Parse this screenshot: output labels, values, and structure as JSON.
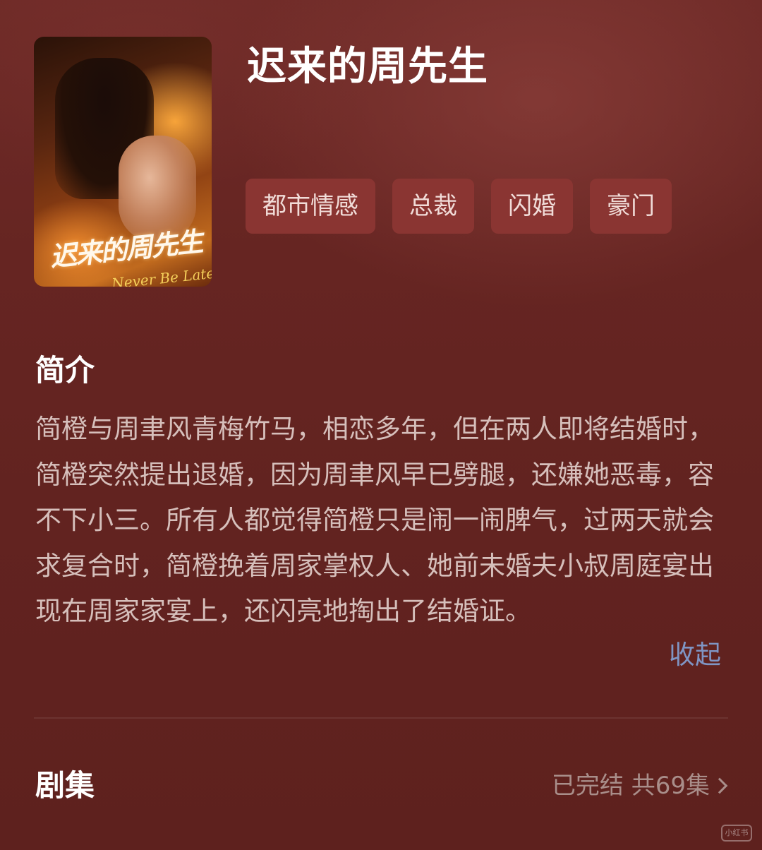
{
  "show": {
    "title": "迟来的周先生",
    "poster": {
      "title_text": "迟来的周先生",
      "subtitle_text": "Never Be Late"
    },
    "tags": [
      "都市情感",
      "总裁",
      "闪婚",
      "豪门"
    ]
  },
  "intro": {
    "heading": "简介",
    "text": "简橙与周聿风青梅竹马，相恋多年，但在两人即将结婚时，简橙突然提出退婚，因为周聿风早已劈腿，还嫌她恶毒，容不下小三。所有人都觉得简橙只是闹一闹脾气，过两天就会求复合时，简橙挽着周家掌权人、她前未婚夫小叔周庭宴出现在周家家宴上，还闪亮地掏出了结婚证。",
    "collapse_label": "收起"
  },
  "episodes": {
    "heading": "剧集",
    "status": "已完结 共69集"
  },
  "watermark": "小红书",
  "colors": {
    "background": "#62221f",
    "tag_background": "#8a3532",
    "link": "#7f95c4"
  }
}
